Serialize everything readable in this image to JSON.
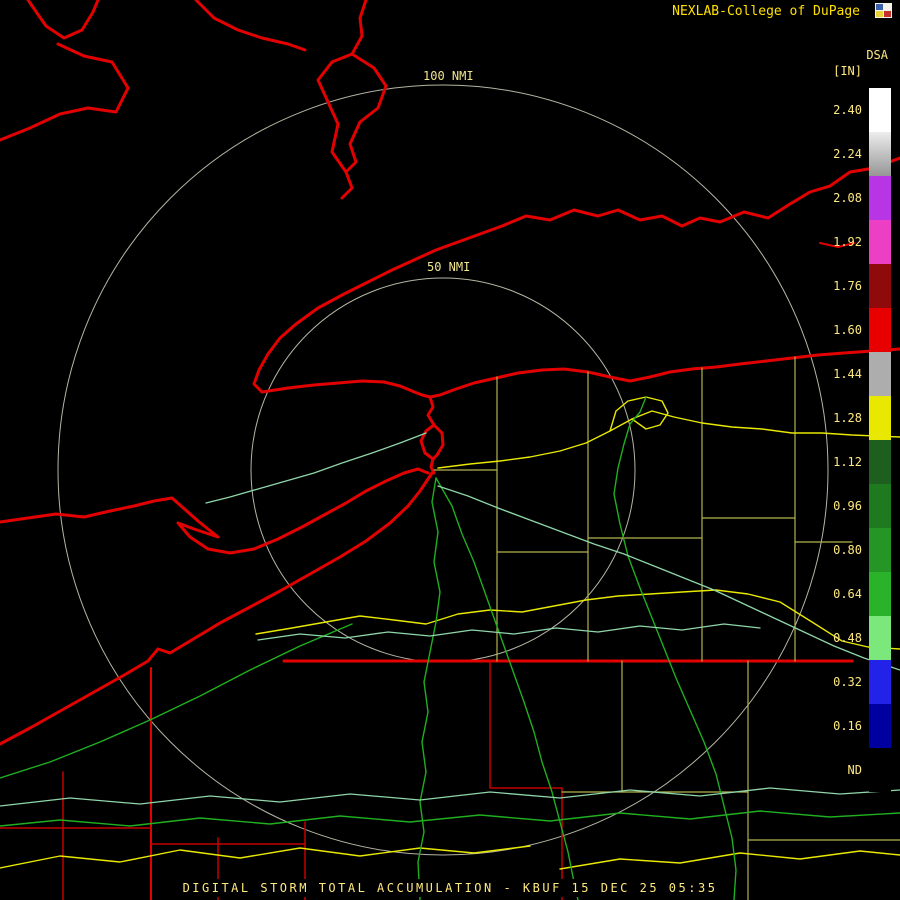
{
  "header": {
    "brand": "NEXLAB-College of DuPage",
    "logo_icon": "cod-logo"
  },
  "product": {
    "code": "DSA",
    "units": "[IN]"
  },
  "colors": {
    "background": "#000000",
    "brand_text": "#FFE100",
    "scale_text": "#FFE97F",
    "map_label_text": "#F0E68C",
    "shoreline": "#E20000",
    "thin_boundary": "#C40000",
    "county_line": "#B2B24E",
    "road_primary": "#E8E800",
    "road_secondary": "#1FAF1F",
    "road_minor": "#8FD6A8",
    "range_ring": "#C9C9B6"
  },
  "colorbar": {
    "segments": [
      {
        "label": "2.40",
        "color": "#FFFFFF"
      },
      {
        "label": "2.24",
        "color": "#EDEDED",
        "color2": "#969696"
      },
      {
        "label": "2.08",
        "color": "#B835E6"
      },
      {
        "label": "1.92",
        "color": "#ED3FC3"
      },
      {
        "label": "1.76",
        "color": "#8F0A0A"
      },
      {
        "label": "1.60",
        "color": "#E80000"
      },
      {
        "label": "1.44",
        "color": "#ADADAD"
      },
      {
        "label": "1.28",
        "color": "#E8E800"
      },
      {
        "label": "1.12",
        "color": "#1E5E1E"
      },
      {
        "label": "0.96",
        "color": "#1F7A1F"
      },
      {
        "label": "0.80",
        "color": "#259625"
      },
      {
        "label": "0.64",
        "color": "#2BB22B"
      },
      {
        "label": "0.48",
        "color": "#7CE87C"
      },
      {
        "label": "0.32",
        "color": "#2222E8"
      },
      {
        "label": "0.16",
        "color": "#0000A0"
      },
      {
        "label": "ND",
        "color": "#000000"
      }
    ]
  },
  "map": {
    "range_rings": [
      {
        "label": "100 NMI"
      },
      {
        "label": "50 NMI"
      }
    ]
  },
  "caption": "DIGITAL STORM TOTAL ACCUMULATION - KBUF 15 DEC 25 05:35"
}
